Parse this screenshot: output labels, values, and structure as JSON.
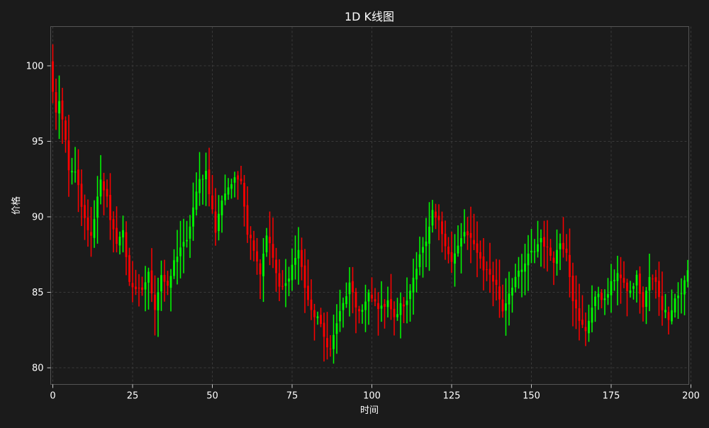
{
  "chart_data": {
    "type": "candlestick",
    "title": "1D K线图",
    "xlabel": "时间",
    "ylabel": "价格",
    "xlim": [
      0,
      200
    ],
    "ylim": [
      78.9,
      102.6
    ],
    "x_ticks": [
      0,
      25,
      50,
      75,
      100,
      125,
      150,
      175,
      200
    ],
    "y_ticks": [
      80,
      85,
      90,
      95,
      100
    ],
    "grid": true,
    "up_color": "#00ff00",
    "down_color": "#ff0000",
    "background": "#1b1b1b",
    "close_anchors": [
      [
        0,
        98.2
      ],
      [
        1,
        97.0
      ],
      [
        2,
        97.6
      ],
      [
        3,
        96.2
      ],
      [
        4,
        95.0
      ],
      [
        5,
        93.0
      ],
      [
        6,
        93.2
      ],
      [
        7,
        92.8
      ],
      [
        8,
        92.0
      ],
      [
        9,
        90.5
      ],
      [
        10,
        89.8
      ],
      [
        11,
        89.2
      ],
      [
        12,
        88.6
      ],
      [
        13,
        90.0
      ],
      [
        15,
        92.6
      ],
      [
        17,
        91.2
      ],
      [
        18,
        89.6
      ],
      [
        20,
        88.4
      ],
      [
        22,
        89.0
      ],
      [
        24,
        85.8
      ],
      [
        26,
        85.0
      ],
      [
        28,
        85.2
      ],
      [
        30,
        86.2
      ],
      [
        32,
        84.0
      ],
      [
        34,
        86.2
      ],
      [
        36,
        85.2
      ],
      [
        38,
        87.0
      ],
      [
        40,
        88.0
      ],
      [
        42,
        88.3
      ],
      [
        44,
        90.6
      ],
      [
        46,
        92.4
      ],
      [
        48,
        93.0
      ],
      [
        50,
        90.4
      ],
      [
        51,
        89.0
      ],
      [
        53,
        91.2
      ],
      [
        55,
        92.0
      ],
      [
        57,
        92.4
      ],
      [
        59,
        92.6
      ],
      [
        61,
        89.0
      ],
      [
        63,
        88.0
      ],
      [
        65,
        86.3
      ],
      [
        67,
        88.9
      ],
      [
        69,
        87.3
      ],
      [
        71,
        85.2
      ],
      [
        73,
        85.5
      ],
      [
        75,
        86.8
      ],
      [
        77,
        87.8
      ],
      [
        79,
        85.4
      ],
      [
        81,
        83.6
      ],
      [
        83,
        83.4
      ],
      [
        85,
        82.0
      ],
      [
        87,
        81.2
      ],
      [
        89,
        83.0
      ],
      [
        91,
        84.2
      ],
      [
        93,
        85.5
      ],
      [
        95,
        84.0
      ],
      [
        97,
        83.8
      ],
      [
        99,
        84.8
      ],
      [
        101,
        84.3
      ],
      [
        103,
        83.9
      ],
      [
        105,
        84.6
      ],
      [
        107,
        83.2
      ],
      [
        109,
        84.1
      ],
      [
        111,
        84.3
      ],
      [
        113,
        86.0
      ],
      [
        115,
        87.6
      ],
      [
        117,
        88.2
      ],
      [
        119,
        90.2
      ],
      [
        121,
        89.6
      ],
      [
        123,
        88.3
      ],
      [
        125,
        87.0
      ],
      [
        127,
        88.0
      ],
      [
        129,
        89.0
      ],
      [
        131,
        88.4
      ],
      [
        133,
        87.8
      ],
      [
        135,
        86.6
      ],
      [
        137,
        86.2
      ],
      [
        139,
        85.4
      ],
      [
        141,
        83.8
      ],
      [
        143,
        85.0
      ],
      [
        145,
        86.0
      ],
      [
        147,
        86.4
      ],
      [
        149,
        87.4
      ],
      [
        151,
        87.8
      ],
      [
        153,
        88.6
      ],
      [
        155,
        87.8
      ],
      [
        157,
        87.2
      ],
      [
        159,
        88.3
      ],
      [
        161,
        87.8
      ],
      [
        163,
        84.6
      ],
      [
        165,
        83.0
      ],
      [
        167,
        82.5
      ],
      [
        169,
        84.0
      ],
      [
        171,
        85.0
      ],
      [
        173,
        84.4
      ],
      [
        175,
        85.5
      ],
      [
        177,
        86.4
      ],
      [
        179,
        85.4
      ],
      [
        181,
        85.0
      ],
      [
        183,
        86.0
      ],
      [
        185,
        84.0
      ],
      [
        187,
        86.0
      ],
      [
        189,
        85.6
      ],
      [
        191,
        84.0
      ],
      [
        193,
        83.4
      ],
      [
        195,
        84.6
      ],
      [
        197,
        85.0
      ],
      [
        199,
        86.4
      ]
    ]
  }
}
